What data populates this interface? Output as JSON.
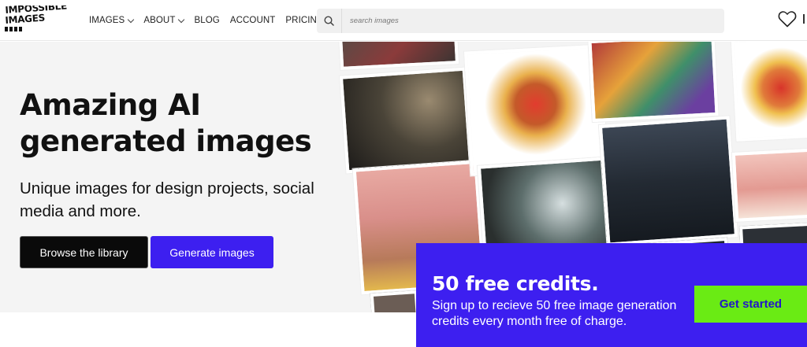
{
  "logo": {
    "line1": "IMPOSSIBLE",
    "line2": "IMAGES"
  },
  "nav": {
    "items": [
      {
        "label": "IMAGES",
        "dropdown": true
      },
      {
        "label": "ABOUT",
        "dropdown": true
      },
      {
        "label": "BLOG",
        "dropdown": false
      },
      {
        "label": "ACCOUNT",
        "dropdown": false
      },
      {
        "label": "PRICING",
        "dropdown": false
      }
    ]
  },
  "search": {
    "placeholder": "search images",
    "value": ""
  },
  "hero": {
    "title": "Amazing AI generated images",
    "subtitle": "Unique images for design projects, social media and more.",
    "browse_label": "Browse the library",
    "generate_label": "Generate images"
  },
  "promo": {
    "title": "50 free credits.",
    "text": "Sign up to recieve 50 free image generation credits every month free of charge.",
    "cta_label": "Get started"
  },
  "colors": {
    "accent": "#3d1ff0",
    "cta_green": "#6aeb14",
    "dark_button": "#0a0a0a",
    "hero_bg": "#f4f4f4"
  },
  "icons": [
    "search-icon",
    "heart-icon",
    "chevron-down-icon"
  ]
}
